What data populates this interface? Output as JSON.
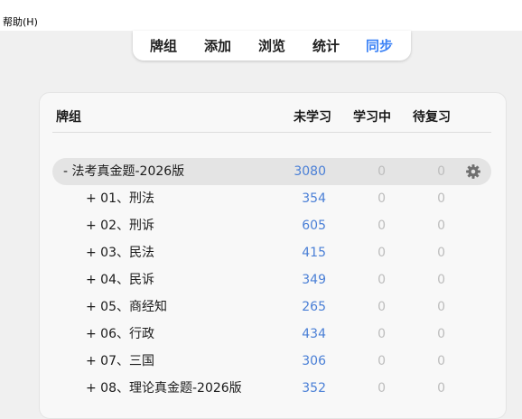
{
  "menu": {
    "help": "帮助(H)"
  },
  "toolbar": {
    "items": [
      "牌组",
      "添加",
      "浏览",
      "统计",
      "同步"
    ],
    "active_index": 4
  },
  "colors": {
    "accent": "#3b82f6",
    "new_count": "#4a7fd6",
    "zero_count": "#bdbdbd"
  },
  "table": {
    "headers": {
      "deck": "牌组",
      "new": "未学习",
      "learning": "学习中",
      "review": "待复习"
    },
    "rows": [
      {
        "toggle": "-",
        "name": "法考真金题-2026版",
        "new": "3080",
        "learning": "0",
        "review": "0",
        "gear": "gear-icon"
      },
      {
        "toggle": "+",
        "name": "01、刑法",
        "new": "354",
        "learning": "0",
        "review": "0"
      },
      {
        "toggle": "+",
        "name": "02、刑诉",
        "new": "605",
        "learning": "0",
        "review": "0"
      },
      {
        "toggle": "+",
        "name": "03、民法",
        "new": "415",
        "learning": "0",
        "review": "0"
      },
      {
        "toggle": "+",
        "name": "04、民诉",
        "new": "349",
        "learning": "0",
        "review": "0"
      },
      {
        "toggle": "+",
        "name": "05、商经知",
        "new": "265",
        "learning": "0",
        "review": "0"
      },
      {
        "toggle": "+",
        "name": "06、行政",
        "new": "434",
        "learning": "0",
        "review": "0"
      },
      {
        "toggle": "+",
        "name": "07、三国",
        "new": "306",
        "learning": "0",
        "review": "0"
      },
      {
        "toggle": "+",
        "name": "08、理论真金题-2026版",
        "new": "352",
        "learning": "0",
        "review": "0"
      }
    ]
  }
}
